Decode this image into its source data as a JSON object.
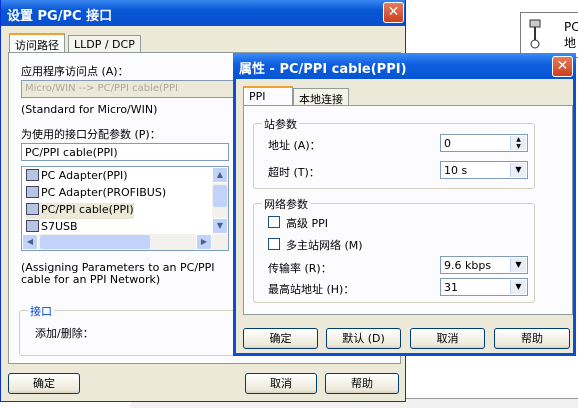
{
  "main": {
    "title": "设置 PG/PC 接口",
    "tabs": [
      "访问路径",
      "LLDP / DCP"
    ],
    "access_point_label": "应用程序访问点 (A)：",
    "access_point_value": "Micro/WIN      --> PC/PPI cable(PPI",
    "access_point_desc": "(Standard for Micro/WIN)",
    "param_label": "为使用的接口分配参数 (P)：",
    "param_value": "PC/PPI cable(PPI)",
    "interfaces": [
      "PC Adapter(PPI)",
      "PC Adapter(PROFIBUS)",
      "PC/PPI cable(PPI)",
      "S7USB"
    ],
    "selected_interface": "PC/PPI cable(PPI)",
    "desc_line1": "(Assigning Parameters to an PC/PPI",
    "desc_line2": "cable for an PPI Network)",
    "interface_group": "接口",
    "add_remove": "添加/删除：",
    "ok": "确定",
    "cancel": "取消",
    "help": "帮助"
  },
  "props": {
    "title": "属性 - PC/PPI cable(PPI)",
    "tabs": [
      "PPI",
      "本地连接"
    ],
    "station_group": "站参数",
    "address_label": "地址 (A)：",
    "address_value": "0",
    "timeout_label": "超时 (T)：",
    "timeout_value": "10 s",
    "network_group": "网络参数",
    "advanced_ppi": "高级 PPI",
    "multi_master": "多主站网络 (M)",
    "baud_label": "传输率 (R)：",
    "baud_value": "9.6 kbps",
    "highest_label": "最高站地址 (H)：",
    "highest_value": "31",
    "ok": "确定",
    "default": "默认 (D)",
    "cancel": "取消",
    "help": "帮助"
  },
  "background": {
    "label_pc": "PC",
    "label_di": "地"
  },
  "close_glyph": "✕"
}
